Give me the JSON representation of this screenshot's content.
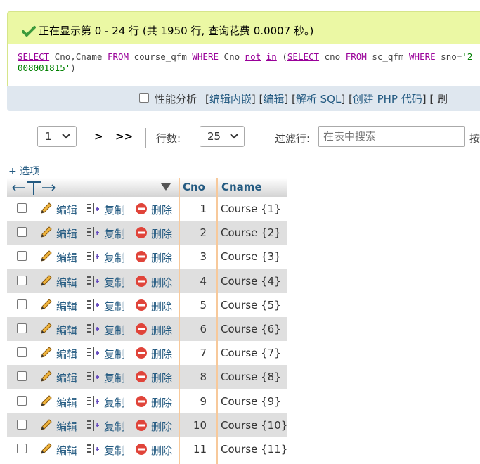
{
  "banner": {
    "message": "正在显示第 0 - 24 行 (共 1950 行, 查询花费 0.0007 秒。)"
  },
  "sql": {
    "kw_select1": "SELECT",
    "part1": " Cno,Cname ",
    "kw_from1": "FROM",
    "part2": " course_qfm ",
    "kw_where1": "WHERE",
    "part3": " Cno ",
    "kw_not": "not",
    "space": " ",
    "kw_in": "in",
    "part4": " (",
    "kw_select2": "SELECT",
    "part5": " cno ",
    "kw_from2": "FROM",
    "part6": " sc_qfm ",
    "kw_where2": "WHERE",
    "part7": " sno=",
    "str": "'2008001815'",
    "part8": ")"
  },
  "tools": {
    "profiling_label": "性能分析",
    "open": "[",
    "edit_inline": "编辑内嵌",
    "sep": "] [",
    "edit": "编辑",
    "explain": "解析 SQL",
    "create_php": "创建 PHP 代码",
    "refresh_partial": "] [ 刷"
  },
  "nav": {
    "page_value": "1",
    "next": ">",
    "last": ">>",
    "rows_label": "行数:",
    "rows_value": "25",
    "filter_label": "过滤行:",
    "filter_placeholder": "在表中搜索",
    "sort_partial": "按"
  },
  "options_label": "+ 选项",
  "table": {
    "headers": [
      "Cno",
      "Cname"
    ],
    "actions": {
      "edit": "编辑",
      "copy": "复制",
      "delete": "删除"
    },
    "rows": [
      {
        "cno": "1",
        "cname": "Course {1}"
      },
      {
        "cno": "2",
        "cname": "Course {2}"
      },
      {
        "cno": "3",
        "cname": "Course {3}"
      },
      {
        "cno": "4",
        "cname": "Course {4}"
      },
      {
        "cno": "5",
        "cname": "Course {5}"
      },
      {
        "cno": "6",
        "cname": "Course {6}"
      },
      {
        "cno": "7",
        "cname": "Course {7}"
      },
      {
        "cno": "8",
        "cname": "Course {8}"
      },
      {
        "cno": "9",
        "cname": "Course {9}"
      },
      {
        "cno": "10",
        "cname": "Course {10}"
      },
      {
        "cno": "11",
        "cname": "Course {11}"
      }
    ]
  },
  "colors": {
    "banner_bg": "#ebf8a4",
    "link": "#235a81",
    "keyword": "#990099",
    "string": "#008000",
    "row_alt": "#dfdfdf",
    "column_separator": "#f7c99b"
  }
}
